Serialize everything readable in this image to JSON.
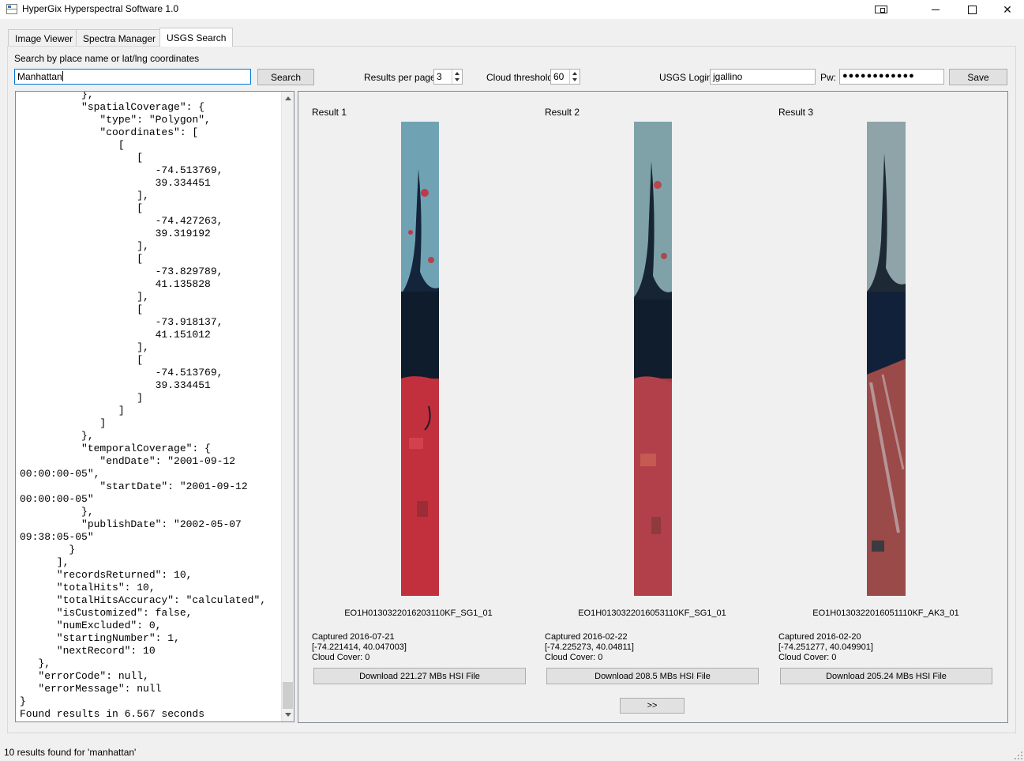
{
  "window": {
    "title": "HyperGix Hyperspectral Software 1.0",
    "minimize_glyph": "—",
    "close_glyph": "✕"
  },
  "tabs": [
    {
      "label": "Image Viewer",
      "active": false
    },
    {
      "label": "Spectra Manager",
      "active": false
    },
    {
      "label": "USGS Search",
      "active": true
    }
  ],
  "search": {
    "hint": "Search by place name or lat/lng coordinates",
    "value": "Manhattan",
    "button_label": "Search"
  },
  "results_per_page": {
    "label": "Results per page",
    "value": "3"
  },
  "cloud_threshold": {
    "label": "Cloud threshold",
    "value": "60"
  },
  "login": {
    "label": "USGS Login:",
    "value": "jgallino",
    "pw_label": "Pw:",
    "pw_value": "●●●●●●●●●●●●",
    "save_label": "Save"
  },
  "json_output": "          },\n          \"spatialCoverage\": {\n             \"type\": \"Polygon\",\n             \"coordinates\": [\n                [\n                   [\n                      -74.513769,\n                      39.334451\n                   ],\n                   [\n                      -74.427263,\n                      39.319192\n                   ],\n                   [\n                      -73.829789,\n                      41.135828\n                   ],\n                   [\n                      -73.918137,\n                      41.151012\n                   ],\n                   [\n                      -74.513769,\n                      39.334451\n                   ]\n                ]\n             ]\n          },\n          \"temporalCoverage\": {\n             \"endDate\": \"2001-09-12\n00:00:00-05\",\n             \"startDate\": \"2001-09-12\n00:00:00-05\"\n          },\n          \"publishDate\": \"2002-05-07\n09:38:05-05\"\n        }\n      ],\n      \"recordsReturned\": 10,\n      \"totalHits\": 10,\n      \"totalHitsAccuracy\": \"calculated\",\n      \"isCustomized\": false,\n      \"numExcluded\": 0,\n      \"startingNumber\": 1,\n      \"nextRecord\": 10\n   },\n   \"errorCode\": null,\n   \"errorMessage\": null\n}\nFound results in 6.567 seconds",
  "results": [
    {
      "title": "Result 1",
      "filename": "EO1H0130322016203110KF_SG1_01",
      "captured": "Captured 2016-07-21",
      "coords": "[-74.221414, 40.047003]",
      "cloud": "Cloud Cover: 0",
      "download_label": "Download 221.27 MBs HSI File"
    },
    {
      "title": "Result 2",
      "filename": "EO1H0130322016053110KF_SG1_01",
      "captured": "Captured 2016-02-22",
      "coords": "[-74.225273, 40.04811]",
      "cloud": "Cloud Cover: 0",
      "download_label": "Download 208.5 MBs HSI File"
    },
    {
      "title": "Result 3",
      "filename": "EO1H0130322016051110KF_AK3_01",
      "captured": "Captured 2016-02-20",
      "coords": "[-74.251277, 40.049901]",
      "cloud": "Cloud Cover: 0",
      "download_label": "Download 205.24 MBs HSI File"
    }
  ],
  "next_label": ">>",
  "status": "10 results found for 'manhattan'",
  "colors": {
    "vegetation_red": "#c8323c",
    "urban_cyan": "#7fb6c8",
    "water_dark": "#0f1e2e",
    "focus_blue": "#0078d7"
  }
}
